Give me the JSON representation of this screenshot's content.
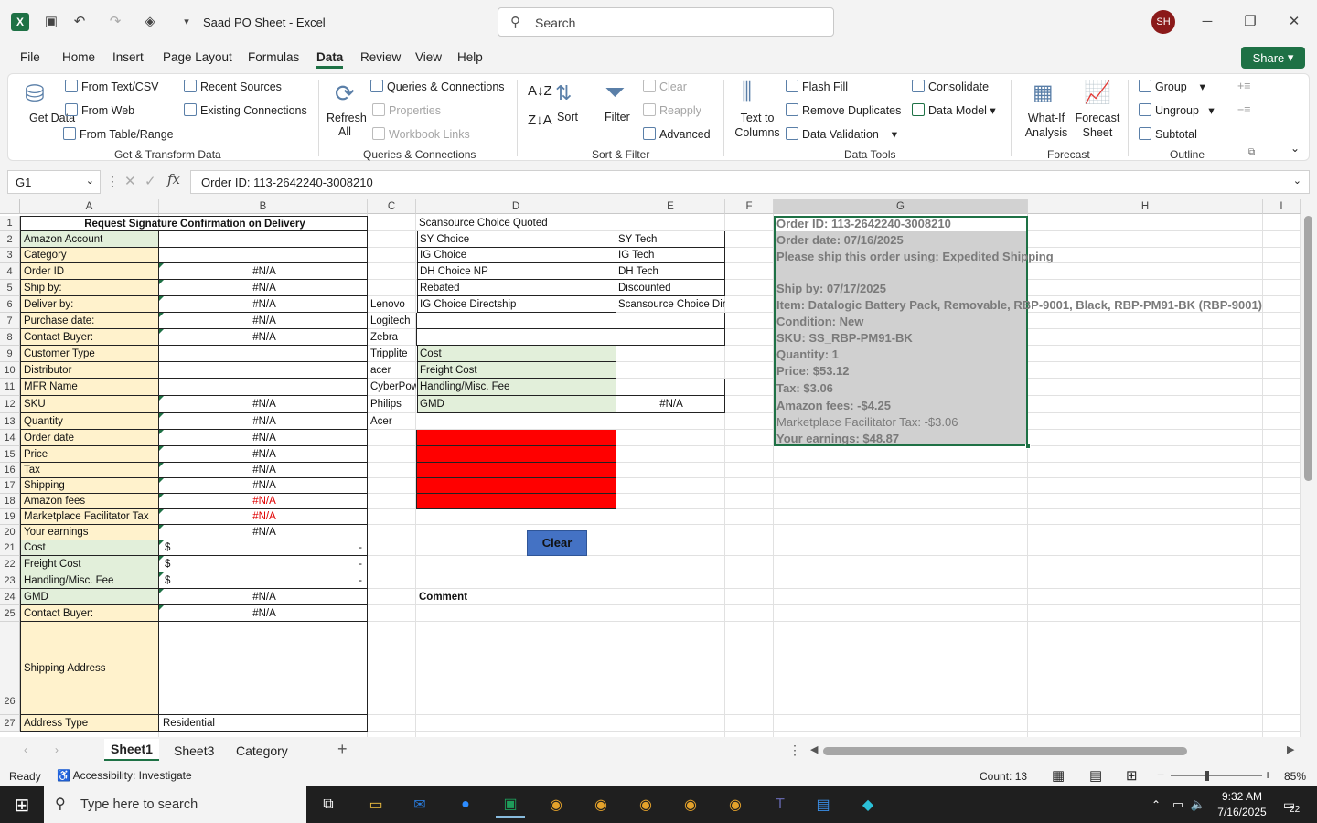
{
  "titlebar": {
    "title": "Saad PO Sheet - Excel",
    "search_placeholder": "Search",
    "avatar": "SH"
  },
  "menu": [
    "File",
    "Home",
    "Insert",
    "Page Layout",
    "Formulas",
    "Data",
    "Review",
    "View",
    "Help"
  ],
  "share_label": "Share",
  "ribbon": {
    "get_data": "Get Data",
    "from_text": "From Text/CSV",
    "from_web": "From Web",
    "from_table": "From Table/Range",
    "recent_sources": "Recent Sources",
    "existing_connections": "Existing Connections",
    "group1": "Get & Transform Data",
    "refresh": "Refresh All",
    "queries_connections": "Queries & Connections",
    "properties": "Properties",
    "workbook_links": "Workbook Links",
    "group2": "Queries & Connections",
    "sort": "Sort",
    "filter": "Filter",
    "clear": "Clear",
    "reapply": "Reapply",
    "advanced": "Advanced",
    "group3": "Sort & Filter",
    "text_to_columns": "Text to Columns",
    "flash_fill": "Flash Fill",
    "remove_duplicates": "Remove Duplicates",
    "data_validation": "Data Validation",
    "consolidate": "Consolidate",
    "data_model": "Data Model",
    "group4": "Data Tools",
    "what_if": "What-If Analysis",
    "forecast_sheet": "Forecast Sheet",
    "group5": "Forecast",
    "group_btn": "Group",
    "ungroup": "Ungroup",
    "subtotal": "Subtotal",
    "group6": "Outline"
  },
  "formula_bar": {
    "name_box": "G1",
    "formula": "Order ID: 113-2642240-3008210"
  },
  "columns": [
    "A",
    "B",
    "C",
    "D",
    "E",
    "F",
    "G",
    "H",
    "I"
  ],
  "col_a": [
    "Request Signature Confirmation on Delivery",
    "Amazon Account",
    "Category",
    "Order ID",
    "Ship by:",
    "Deliver by:",
    "Purchase date:",
    "Contact Buyer:",
    "Customer Type",
    "Distributor",
    "MFR Name",
    "SKU",
    "Quantity",
    "Order date",
    "Price",
    "Tax",
    "Shipping",
    "Amazon fees",
    "Marketplace Facilitator Tax",
    "Your earnings",
    "Cost",
    "Freight Cost",
    "Handling/Misc. Fee",
    "GMD",
    "Contact Buyer:",
    "Shipping Address",
    "Address Type"
  ],
  "col_b": [
    "",
    "",
    "",
    "#N/A",
    "#N/A",
    "#N/A",
    "#N/A",
    "#N/A",
    "",
    "",
    "",
    "#N/A",
    "#N/A",
    "#N/A",
    "#N/A",
    "#N/A",
    "#N/A",
    "#N/A",
    "#N/A",
    "#N/A",
    "$",
    "$",
    "$",
    "#N/A",
    "#N/A",
    "",
    "Residential"
  ],
  "dash": "-",
  "col_c": {
    "6": "Lenovo",
    "7": "Logitech",
    "8": "Zebra",
    "9": "Tripplite",
    "10": "acer",
    "11": "CyberPow",
    "12": "Philips",
    "13": "Acer"
  },
  "col_d": {
    "1": "Scansource Choice Quoted",
    "2": "SY Choice",
    "3": "IG Choice",
    "4": "DH Choice NP",
    "5": " Rebated",
    "6": "IG Choice Directship",
    "9": "Cost",
    "10": "Freight Cost",
    "11": "Handling/Misc. Fee",
    "12": "GMD",
    "24": "Comment"
  },
  "col_e": {
    "2": "SY Tech",
    "3": "IG Tech",
    "4": "DH Tech",
    "5": " Discounted",
    "6": "Scansource Choice Directship",
    "12": "#N/A"
  },
  "clear_button": "Clear",
  "col_g": [
    "Order ID: 113-2642240-3008210",
    "Order date: 07/16/2025",
    "Please ship this order using: Expedited Shipping",
    "",
    "Ship by: 07/17/2025",
    "Item: Datalogic Battery Pack, Removable, RBP-9001, Black, RBP-PM91-BK (RBP-9001)",
    "Condition: New",
    "SKU: SS_RBP-PM91-BK",
    "Quantity: 1",
    "Price: $53.12",
    "Tax: $3.06",
    "Amazon fees: -$4.25",
    "Marketplace Facilitator Tax: -$3.06",
    "Your earnings: $48.87"
  ],
  "rows": [
    "1",
    "2",
    "3",
    "4",
    "5",
    "6",
    "7",
    "8",
    "9",
    "10",
    "11",
    "12",
    "13",
    "14",
    "15",
    "16",
    "17",
    "18",
    "19",
    "20",
    "21",
    "22",
    "23",
    "24",
    "25",
    "26",
    "27"
  ],
  "sheets": [
    "Sheet1",
    "Sheet3",
    "Category"
  ],
  "status": {
    "ready": "Ready",
    "accessibility": "Accessibility: Investigate",
    "count": "Count: 13",
    "zoom": "85%"
  },
  "taskbar": {
    "search": "Type here to search",
    "time": "9:32 AM",
    "date": "7/16/2025",
    "notif": "22"
  }
}
